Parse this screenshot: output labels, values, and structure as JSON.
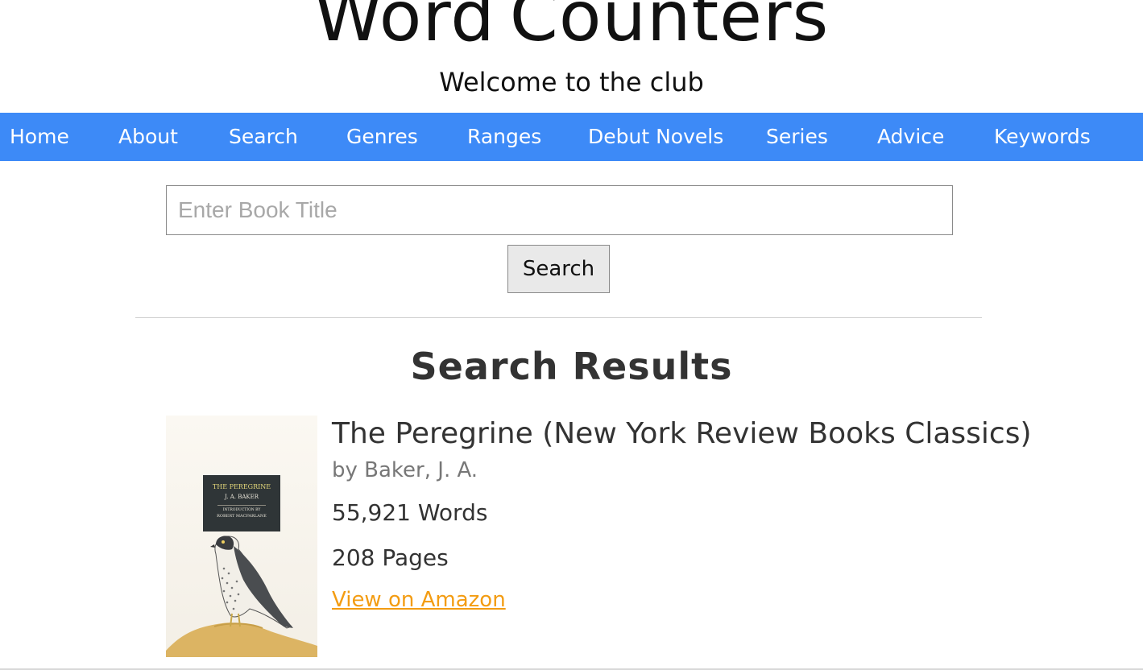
{
  "header": {
    "title_word1": "Word",
    "title_word2": "Counters",
    "tagline": "Welcome to the club"
  },
  "nav": {
    "items": [
      "Home",
      "About",
      "Search",
      "Genres",
      "Ranges",
      "Debut Novels",
      "Series",
      "Advice",
      "Keywords"
    ],
    "background": "#3d8af7"
  },
  "search": {
    "placeholder": "Enter Book Title",
    "value": "",
    "button_label": "Search"
  },
  "results": {
    "heading": "Search Results",
    "items": [
      {
        "title": "The Peregrine (New York Review Books Classics)",
        "author": "by Baker, J. A.",
        "words": "55,921 Words",
        "pages": "208 Pages",
        "link_label": "View on Amazon",
        "cover_text": {
          "title": "THE PEREGRINE",
          "author": "J. A. BAKER",
          "intro": "INTRODUCTION BY",
          "intro_author": "ROBERT MACFARLANE"
        }
      }
    ]
  },
  "colors": {
    "link": "#f39c12",
    "heading": "#333333"
  }
}
